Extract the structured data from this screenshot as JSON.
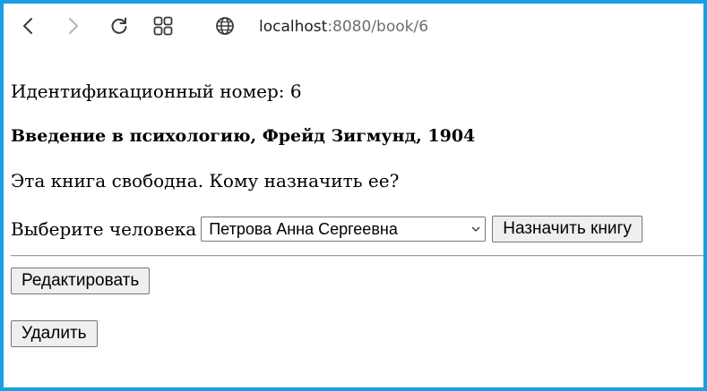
{
  "browser": {
    "address_host": "localhost",
    "address_rest": ":8080/book/6",
    "icons": {
      "back": "back-arrow-icon",
      "forward": "forward-arrow-icon",
      "reload": "reload-icon",
      "tabs": "tab-grid-icon",
      "site": "globe-icon"
    }
  },
  "book": {
    "id_line": "Идентификационный номер: 6",
    "title_line": "Введение в психологию, Фрейд Зигмунд, 1904",
    "status_line": "Эта книга свободна. Кому назначить ее?"
  },
  "assign": {
    "label": "Выберите человека",
    "selected_person": "Петрова Анна Сергеевна",
    "button_label": "Назначить книгу"
  },
  "actions": {
    "edit_label": "Редактировать",
    "delete_label": "Удалить"
  },
  "colors": {
    "window_border": "#1a9ee6",
    "button_background": "#efefef",
    "address_secondary": "#6e6e6e"
  }
}
